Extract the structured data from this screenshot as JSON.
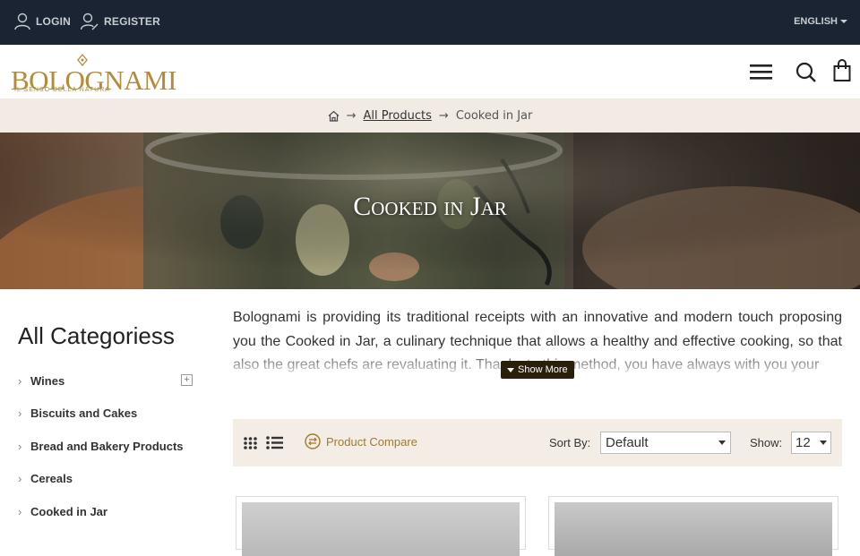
{
  "topbar": {
    "login_label": "LOGIN",
    "register_label": "REGISTER",
    "language": "ENGLISH"
  },
  "header": {
    "logo_text": "BOLOGNAMI",
    "logo_tagline": "IL SENSO DELLA NATURA"
  },
  "breadcrumb": {
    "separator": "→",
    "all_products": "All Products",
    "current": "Cooked in Jar"
  },
  "hero": {
    "title": "Cooked in Jar"
  },
  "sidebar": {
    "title": "All Categoriess",
    "items": [
      {
        "label": "Wines"
      },
      {
        "label": "Biscuits and Cakes"
      },
      {
        "label": "Bread and Bakery Products"
      },
      {
        "label": "Cereals"
      },
      {
        "label": "Cooked in Jar"
      }
    ]
  },
  "description": {
    "text": "Bolognami is providing its traditional receipts with an innovative and modern touch proposing you the Cooked in Jar, a culinary technique that allows a healthy and effective cooking, so that also the great chefs are revaluating it. Thanks to this method, you have always with you your",
    "show_more": "Show More"
  },
  "toolbar": {
    "compare_label": "Product Compare",
    "sort_label": "Sort By:",
    "sort_value": "Default",
    "show_label": "Show:",
    "show_value": "12"
  },
  "colors": {
    "topbar_bg": "#1b2433",
    "accent_gold": "#b58a3c",
    "breadcrumb_bg": "#f1ebe4",
    "toolbar_bg": "#f3ede6"
  }
}
